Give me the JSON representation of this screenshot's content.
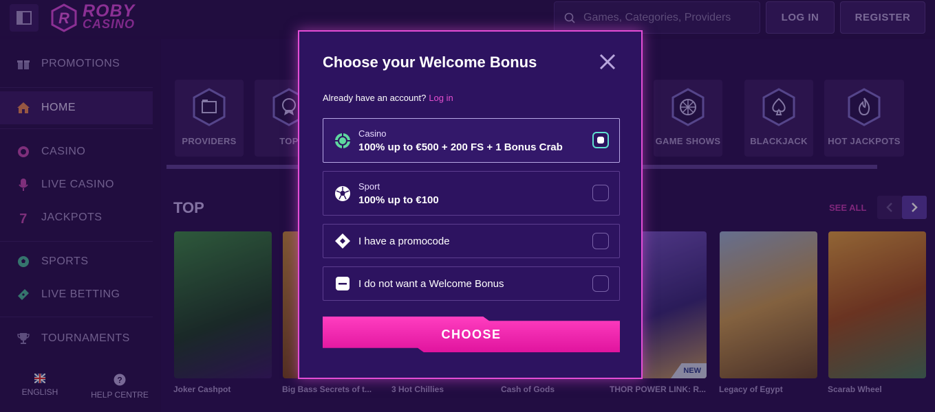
{
  "header": {
    "logo_line1": "ROBY",
    "logo_line2": "CASINO",
    "search_placeholder": "Games, Categories, Providers",
    "login_label": "LOG IN",
    "register_label": "REGISTER"
  },
  "sidebar": {
    "items": [
      {
        "label": "PROMOTIONS",
        "icon": "gift-icon"
      },
      {
        "label": "HOME",
        "icon": "home-icon"
      },
      {
        "label": "CASINO",
        "icon": "casino-chip-icon"
      },
      {
        "label": "LIVE CASINO",
        "icon": "microphone-icon"
      },
      {
        "label": "JACKPOTS",
        "icon": "seven-icon"
      },
      {
        "label": "SPORTS",
        "icon": "soccer-ball-icon"
      },
      {
        "label": "LIVE BETTING",
        "icon": "ticket-icon"
      },
      {
        "label": "TOURNAMENTS",
        "icon": "trophy-icon"
      }
    ],
    "language_label": "ENGLISH",
    "help_label": "HELP CENTRE"
  },
  "categories": [
    {
      "label": "PROVIDERS",
      "icon": "folder-icon"
    },
    {
      "label": "TOP",
      "icon": "badge-icon"
    },
    {
      "label": "GAME SHOWS",
      "icon": "wheel-icon"
    },
    {
      "label": "BLACKJACK",
      "icon": "spade-icon"
    },
    {
      "label": "HOT JACKPOTS",
      "icon": "flame-icon"
    }
  ],
  "top_section": {
    "title": "TOP",
    "see_all": "SEE ALL",
    "games": [
      {
        "name": "Joker Cashpot",
        "color": "#2f6b3c"
      },
      {
        "name": "Big Bass Secrets of t...",
        "color": "#8a5a2a"
      },
      {
        "name": "3 Hot Chillies",
        "color": "#6a1f1f"
      },
      {
        "name": "Cash of Gods",
        "color": "#3d2a6e"
      },
      {
        "name": "THOR POWER LINK: R...",
        "color": "#5a3a8a",
        "badge": "NEW"
      },
      {
        "name": "Legacy of Egypt",
        "color": "#8a6a3a"
      },
      {
        "name": "Scarab Wheel",
        "color": "#b85a1f"
      }
    ]
  },
  "modal": {
    "title": "Choose your Welcome Bonus",
    "account_text": "Already have an account?",
    "login_link": "Log in",
    "options": [
      {
        "label": "Casino",
        "detail": "100% up to €500 + 200 FS + 1 Bonus Crab",
        "selected": true
      },
      {
        "label": "Sport",
        "detail": "100% up to €100",
        "selected": false
      },
      {
        "label": "I have a promocode",
        "selected": false
      },
      {
        "label": "I do not want a Welcome Bonus",
        "selected": false
      }
    ],
    "choose_label": "CHOOSE"
  }
}
